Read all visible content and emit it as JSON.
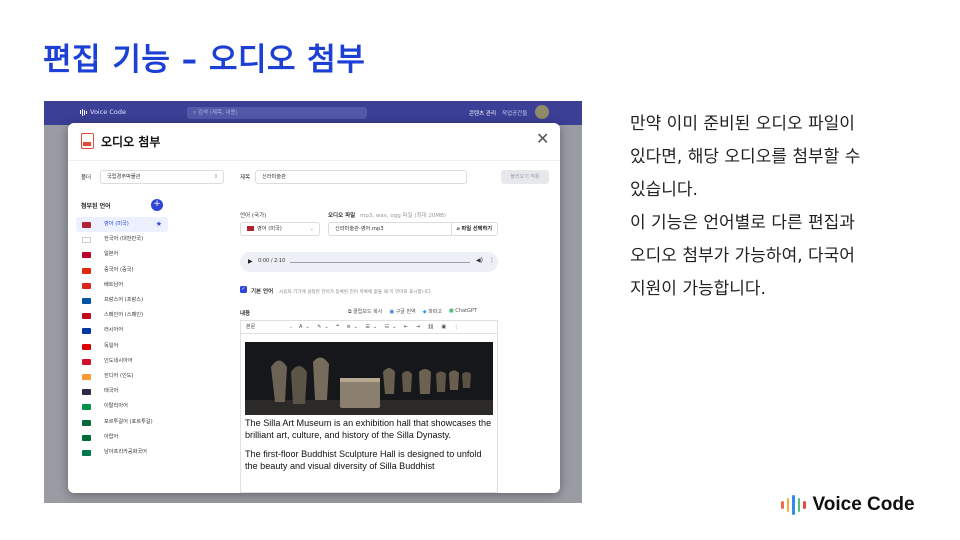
{
  "slide": {
    "title": "편집 기능 – 오디오 첨부",
    "description_lines": [
      "만약 이미 준비된 오디오 파일이",
      "있다면, 해당 오디오를 첨부할 수",
      "있습니다.",
      "이 기능은 언어별로 다른 편집과",
      "오디오 첨부가 가능하여, 다국어",
      "지원이 가능합니다."
    ],
    "brand_name": "Voice Code",
    "brand_colors": [
      "#f26a4b",
      "#f5b02e",
      "#2f8df0",
      "#4ec07a",
      "#e24a3b"
    ]
  },
  "app": {
    "logo": "Voice Code",
    "search_placeholder": "검색 (제목, 내용)",
    "menu_label": "콘텐츠 관리",
    "user_label": "작업공간들",
    "accent": "#2f45d8"
  },
  "modal": {
    "title": "오디오 첨부",
    "folder_label": "폴더",
    "folder_value": "국립경주박물관",
    "subject_label": "제목",
    "subject_value": "신라미술관",
    "apply_button": "불러오기 적용",
    "sidebar_title": "첨부된 언어",
    "languages": [
      {
        "label": "영어 (미국)",
        "flag": "#b22234",
        "active": true
      },
      {
        "label": "한국어 (대한민국)",
        "flag": "#ffffff",
        "active": false
      },
      {
        "label": "일본어",
        "flag": "#bc002d",
        "active": false
      },
      {
        "label": "중국어 (중국)",
        "flag": "#de2910",
        "active": false
      },
      {
        "label": "베트남어",
        "flag": "#da251d",
        "active": false
      },
      {
        "label": "프랑스어 (프랑스)",
        "flag": "#0055a4",
        "active": false
      },
      {
        "label": "스페인어 (스페인)",
        "flag": "#c60b1e",
        "active": false
      },
      {
        "label": "러시아어",
        "flag": "#0039a6",
        "active": false
      },
      {
        "label": "독일어",
        "flag": "#dd0000",
        "active": false
      },
      {
        "label": "인도네시아어",
        "flag": "#ce1126",
        "active": false
      },
      {
        "label": "힌디어 (인도)",
        "flag": "#ff9933",
        "active": false
      },
      {
        "label": "태국어",
        "flag": "#2d2a4a",
        "active": false
      },
      {
        "label": "이탈리아어",
        "flag": "#009246",
        "active": false
      },
      {
        "label": "포르투갈어 (포르투갈)",
        "flag": "#046a38",
        "active": false
      },
      {
        "label": "아랍어",
        "flag": "#006c35",
        "active": false
      },
      {
        "label": "남아프리카공화국어",
        "flag": "#007a4d",
        "active": false
      }
    ],
    "language_label": "언어 (국가)",
    "language_value": "영어 (미국)",
    "audio_label": "오디오 파일",
    "audio_hint": "mp3, wav, ogg 파일 (최대 20MB)",
    "audio_value": "신라미술관-영어.mp3",
    "select_file_button": "파일 선택하기",
    "player_time": "0:00 / 2:10",
    "default_lang_label": "기본 언어",
    "default_lang_hint": "사용자 기기에 설정된 언어가 등록된 언어 목록에 없을 때 이 언어로 표시합니다.",
    "content_label": "내용",
    "tools": [
      "클립보드 복사",
      "구글 번역",
      "파파고",
      "ChatGPT"
    ],
    "format_label": "본문",
    "editor_text": [
      "The Silla Art Museum is an exhibition hall that showcases the brilliant art, culture, and history of the Silla Dynasty.",
      "The first-floor Buddhist Sculpture Hall is designed to unfold the beauty and visual diversity of Silla Buddhist"
    ]
  }
}
